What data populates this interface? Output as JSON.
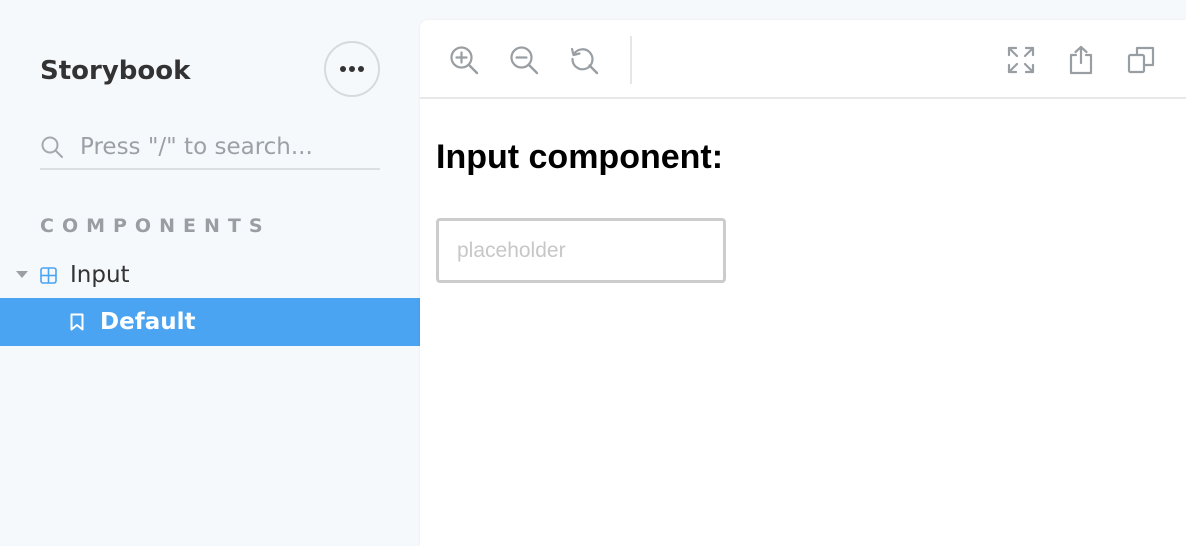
{
  "sidebar": {
    "brand": "Storybook",
    "menu_button_icon": "ellipsis-icon",
    "search": {
      "placeholder": "Press \"/\" to search...",
      "value": ""
    },
    "section_title": "COMPONENTS",
    "tree": {
      "component": {
        "label": "Input",
        "expanded": true,
        "icon": "component-grid-icon"
      },
      "story": {
        "label": "Default",
        "selected": true,
        "icon": "bookmark-icon"
      }
    }
  },
  "toolbar": {
    "left_tools": [
      "zoom-in-icon",
      "zoom-out-icon",
      "reset-zoom-icon"
    ],
    "right_tools": [
      "fullscreen-icon",
      "share-icon",
      "copy-icon"
    ]
  },
  "preview": {
    "heading": "Input component:",
    "input": {
      "placeholder": "placeholder",
      "value": ""
    }
  },
  "colors": {
    "sidebar_bg": "#f6f9fc",
    "selected_bg": "#4aa4f2",
    "icon_gray": "#999ea3",
    "component_icon": "#4aa4f2"
  }
}
